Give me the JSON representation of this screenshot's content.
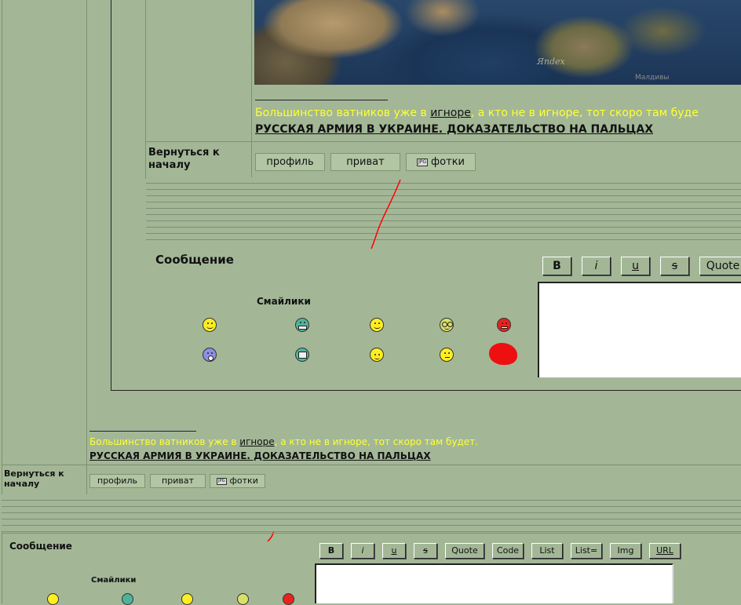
{
  "signature": {
    "yellow_prefix": "Большинство ватников уже в ",
    "ignore_link": "игноре",
    "yellow_suffix": ", а кто не в игноре, тот скоро там будет.",
    "yellow_suffix_cut": ", а кто не в игноре, тот скоро там буде",
    "bold_link": "РУССКАЯ АРМИЯ В УКРАИНЕ. ДОКАЗАТЕЛЬСТВО НА ПАЛЬЦАХ"
  },
  "map": {
    "watermark": "Яndex",
    "watermark_small": "Малдивы"
  },
  "back_to_top": "Вернуться к началу",
  "profile_buttons": {
    "profile": "профиль",
    "private": "приват",
    "photos": "фотки",
    "photos_icon_text": "JPG"
  },
  "message": {
    "label": "Сообщение",
    "smiles_label": "Смайлики"
  },
  "bbcode": {
    "bold": "B",
    "italic": "i",
    "underline": "u",
    "strike": "s",
    "quote": "Quote",
    "code": "Code",
    "list": "List",
    "list_eq": "List=",
    "img": "Img",
    "url": "URL"
  },
  "colors": {
    "background": "#a3b797",
    "signature_yellow": "#ffff33",
    "annotation_red": "#ff0000"
  }
}
